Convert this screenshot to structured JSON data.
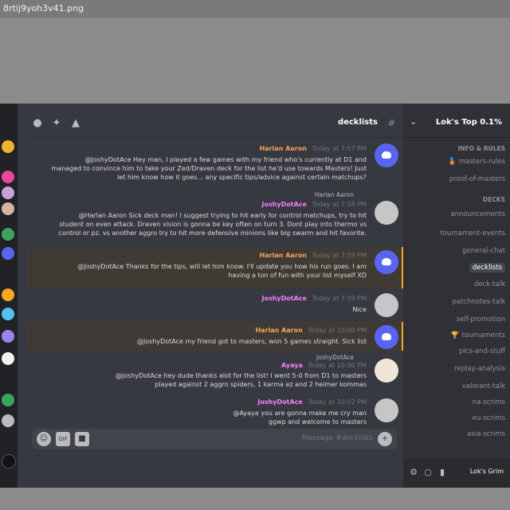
{
  "file_name": "8rtij9yoh3v41.png",
  "server": {
    "name": "Lok's Top 0.1%",
    "user_name": "Lok's Grim"
  },
  "channel": {
    "name": "decklists",
    "message_placeholder": "Message #decklists"
  },
  "sidebar": {
    "categories": [
      "Info & Rules",
      "Decks"
    ],
    "channels": [
      {
        "name": "masters-rules",
        "emoji": "🥉"
      },
      {
        "name": "proof-of-masters",
        "emoji": ""
      },
      {
        "name": "announcements",
        "emoji": ""
      },
      {
        "name": "tournament-events",
        "emoji": ""
      },
      {
        "name": "general-chat",
        "emoji": ""
      },
      {
        "name": "decklists",
        "emoji": ""
      },
      {
        "name": "deck-talk",
        "emoji": ""
      },
      {
        "name": "patchnotes-talk",
        "emoji": ""
      },
      {
        "name": "self-promotion",
        "emoji": ""
      },
      {
        "name": "tournaments",
        "emoji": "🏆"
      },
      {
        "name": "pics-and-stuff",
        "emoji": ""
      },
      {
        "name": "replay-analysis",
        "emoji": ""
      },
      {
        "name": "valorant-talk",
        "emoji": ""
      },
      {
        "name": "na-scrims",
        "emoji": ""
      },
      {
        "name": "eu-scrims",
        "emoji": ""
      },
      {
        "name": "asia-scrims",
        "emoji": ""
      }
    ]
  },
  "messages": [
    {
      "author": "Harlan Aaron",
      "timestamp": "Today at 7:57 PM",
      "lines": [
        "@JoshyDotAce Hey man, I played a few games with my friend who's currently at D1 and",
        "managed to convince him to take your Zed/Draven deck for the list he'd use towards Masters! Just",
        "let him know how it goes... any specific tips/advice against certain matchups?"
      ]
    },
    {
      "author": "JoshyDotAce",
      "timestamp": "Today at 7:58 PM",
      "reply_to": "Harlan Aaron",
      "lines": [
        "@Harlan Aaron Sick deck man! I suggest trying to hit early for control matchups, try to hit",
        "student on even attack. Draven vision is gonna be key often on turn 3. Dont play into thermo vs",
        "control or pz. vs another aggro try to hit more defensive minions like big swarm and hit favorite."
      ]
    },
    {
      "author": "Harlan Aaron",
      "timestamp": "Today at 7:59 PM",
      "highlighted": true,
      "lines": [
        "@JoshyDotAce Thanks for the tips, will let him know. I'll update you how his run goes. I am",
        "having a ton of fun with your list myself XD"
      ]
    },
    {
      "author": "JoshyDotAce",
      "timestamp": "Today at 7:59 PM",
      "lines": [
        "Nice"
      ]
    },
    {
      "author": "Harlan Aaron",
      "timestamp": "Today at 10:00 PM",
      "highlighted": true,
      "lines": [
        "@JoshyDotAce my friend got to masters, won 5 games straight. Sick list"
      ]
    },
    {
      "author": "Ayaya",
      "timestamp": "Today at 10:00 PM",
      "reply_to": "JoshyDotAce",
      "lines": [
        "@JoshyDotAce hey dude thanks alot for the list! I went 5-0 from D1 to masters",
        "played against 2 aggro spiders, 1 karma ez and 2 heimer kommas"
      ]
    },
    {
      "author": "JoshyDotAce",
      "timestamp": "Today at 10:02 PM",
      "lines": [
        "@Ayaya you are gonna make me cry man",
        "ggwp and welcome to masters"
      ]
    }
  ]
}
